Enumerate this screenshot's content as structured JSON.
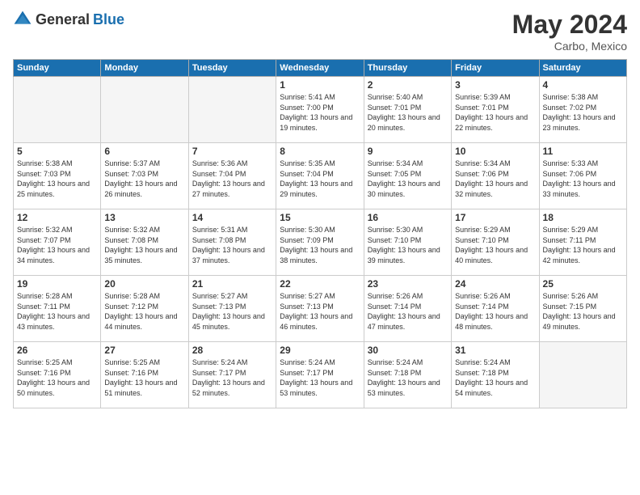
{
  "header": {
    "logo_general": "General",
    "logo_blue": "Blue",
    "month_year": "May 2024",
    "location": "Carbo, Mexico"
  },
  "days_of_week": [
    "Sunday",
    "Monday",
    "Tuesday",
    "Wednesday",
    "Thursday",
    "Friday",
    "Saturday"
  ],
  "weeks": [
    [
      {
        "day": "",
        "empty": true
      },
      {
        "day": "",
        "empty": true
      },
      {
        "day": "",
        "empty": true
      },
      {
        "day": "1",
        "sunrise": "5:41 AM",
        "sunset": "7:00 PM",
        "daylight": "13 hours and 19 minutes."
      },
      {
        "day": "2",
        "sunrise": "5:40 AM",
        "sunset": "7:01 PM",
        "daylight": "13 hours and 20 minutes."
      },
      {
        "day": "3",
        "sunrise": "5:39 AM",
        "sunset": "7:01 PM",
        "daylight": "13 hours and 22 minutes."
      },
      {
        "day": "4",
        "sunrise": "5:38 AM",
        "sunset": "7:02 PM",
        "daylight": "13 hours and 23 minutes."
      }
    ],
    [
      {
        "day": "5",
        "sunrise": "5:38 AM",
        "sunset": "7:03 PM",
        "daylight": "13 hours and 25 minutes."
      },
      {
        "day": "6",
        "sunrise": "5:37 AM",
        "sunset": "7:03 PM",
        "daylight": "13 hours and 26 minutes."
      },
      {
        "day": "7",
        "sunrise": "5:36 AM",
        "sunset": "7:04 PM",
        "daylight": "13 hours and 27 minutes."
      },
      {
        "day": "8",
        "sunrise": "5:35 AM",
        "sunset": "7:04 PM",
        "daylight": "13 hours and 29 minutes."
      },
      {
        "day": "9",
        "sunrise": "5:34 AM",
        "sunset": "7:05 PM",
        "daylight": "13 hours and 30 minutes."
      },
      {
        "day": "10",
        "sunrise": "5:34 AM",
        "sunset": "7:06 PM",
        "daylight": "13 hours and 32 minutes."
      },
      {
        "day": "11",
        "sunrise": "5:33 AM",
        "sunset": "7:06 PM",
        "daylight": "13 hours and 33 minutes."
      }
    ],
    [
      {
        "day": "12",
        "sunrise": "5:32 AM",
        "sunset": "7:07 PM",
        "daylight": "13 hours and 34 minutes."
      },
      {
        "day": "13",
        "sunrise": "5:32 AM",
        "sunset": "7:08 PM",
        "daylight": "13 hours and 35 minutes."
      },
      {
        "day": "14",
        "sunrise": "5:31 AM",
        "sunset": "7:08 PM",
        "daylight": "13 hours and 37 minutes."
      },
      {
        "day": "15",
        "sunrise": "5:30 AM",
        "sunset": "7:09 PM",
        "daylight": "13 hours and 38 minutes."
      },
      {
        "day": "16",
        "sunrise": "5:30 AM",
        "sunset": "7:10 PM",
        "daylight": "13 hours and 39 minutes."
      },
      {
        "day": "17",
        "sunrise": "5:29 AM",
        "sunset": "7:10 PM",
        "daylight": "13 hours and 40 minutes."
      },
      {
        "day": "18",
        "sunrise": "5:29 AM",
        "sunset": "7:11 PM",
        "daylight": "13 hours and 42 minutes."
      }
    ],
    [
      {
        "day": "19",
        "sunrise": "5:28 AM",
        "sunset": "7:11 PM",
        "daylight": "13 hours and 43 minutes."
      },
      {
        "day": "20",
        "sunrise": "5:28 AM",
        "sunset": "7:12 PM",
        "daylight": "13 hours and 44 minutes."
      },
      {
        "day": "21",
        "sunrise": "5:27 AM",
        "sunset": "7:13 PM",
        "daylight": "13 hours and 45 minutes."
      },
      {
        "day": "22",
        "sunrise": "5:27 AM",
        "sunset": "7:13 PM",
        "daylight": "13 hours and 46 minutes."
      },
      {
        "day": "23",
        "sunrise": "5:26 AM",
        "sunset": "7:14 PM",
        "daylight": "13 hours and 47 minutes."
      },
      {
        "day": "24",
        "sunrise": "5:26 AM",
        "sunset": "7:14 PM",
        "daylight": "13 hours and 48 minutes."
      },
      {
        "day": "25",
        "sunrise": "5:26 AM",
        "sunset": "7:15 PM",
        "daylight": "13 hours and 49 minutes."
      }
    ],
    [
      {
        "day": "26",
        "sunrise": "5:25 AM",
        "sunset": "7:16 PM",
        "daylight": "13 hours and 50 minutes."
      },
      {
        "day": "27",
        "sunrise": "5:25 AM",
        "sunset": "7:16 PM",
        "daylight": "13 hours and 51 minutes."
      },
      {
        "day": "28",
        "sunrise": "5:24 AM",
        "sunset": "7:17 PM",
        "daylight": "13 hours and 52 minutes."
      },
      {
        "day": "29",
        "sunrise": "5:24 AM",
        "sunset": "7:17 PM",
        "daylight": "13 hours and 53 minutes."
      },
      {
        "day": "30",
        "sunrise": "5:24 AM",
        "sunset": "7:18 PM",
        "daylight": "13 hours and 53 minutes."
      },
      {
        "day": "31",
        "sunrise": "5:24 AM",
        "sunset": "7:18 PM",
        "daylight": "13 hours and 54 minutes."
      },
      {
        "day": "",
        "empty": true
      }
    ]
  ]
}
